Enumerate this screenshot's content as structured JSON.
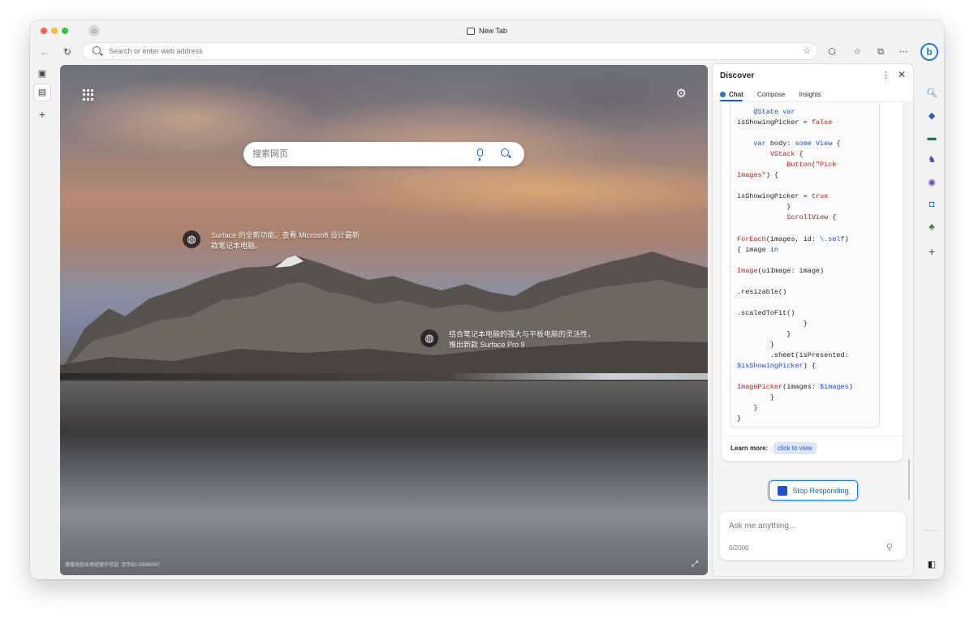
{
  "window": {
    "tab_title": "New Tab"
  },
  "toolbar": {
    "address_placeholder": "Search or enter web address",
    "back_icon": "back-arrow-icon",
    "reload_icon": "reload-icon",
    "bing_label": "b"
  },
  "newtab": {
    "search_placeholder": "搜索网页",
    "hotspot1": "Surface 的全新功能。查看 Microsoft 设计最新款笔记本电脑。",
    "hotspot2": "结合笔记本电脑的强大与平板电脑的灵活性，推出新款 Surface Pro 9",
    "footer": "增值电信业务经营许可证: 合字B2-20090007"
  },
  "sidebar": {
    "title": "Discover",
    "tabs": [
      "Chat",
      "Compose",
      "Insights"
    ],
    "active_tab": "Chat",
    "learn_more_label": "Learn more:",
    "learn_more_link": "click to view",
    "stop_label": "Stop Responding",
    "ask_placeholder": "Ask me anything...",
    "char_counter": "0/2000"
  },
  "code_lines": [
    "    @State var",
    "isShowingPicker = false",
    "",
    "    var body: some View {",
    "        VStack {",
    "            Button(\"Pick",
    "Images\") {",
    "",
    "isShowingPicker = true",
    "            }",
    "            ScrollView {",
    "",
    "ForEach(images, id: \\.self)",
    "{ image in",
    "",
    "Image(uiImage: image)",
    "",
    ".resizable()",
    "",
    ".scaledToFit()",
    "                }",
    "            }",
    "        }",
    "        .sheet(isPresented:",
    "$isShowingPicker) {",
    "",
    "ImagePicker(images: $images)",
    "        }",
    "    }",
    "}"
  ],
  "right_toolbar_icons": [
    "search-icon",
    "tag-icon",
    "briefcase-icon",
    "games-icon",
    "office-icon",
    "outlook-icon",
    "tree-icon",
    "add-icon",
    "sidebar-toggle-icon",
    "settings-icon"
  ],
  "colors": {
    "accent": "#1c78d6",
    "code_keyword": "#1c4fb8",
    "code_type": "#b3201a"
  }
}
